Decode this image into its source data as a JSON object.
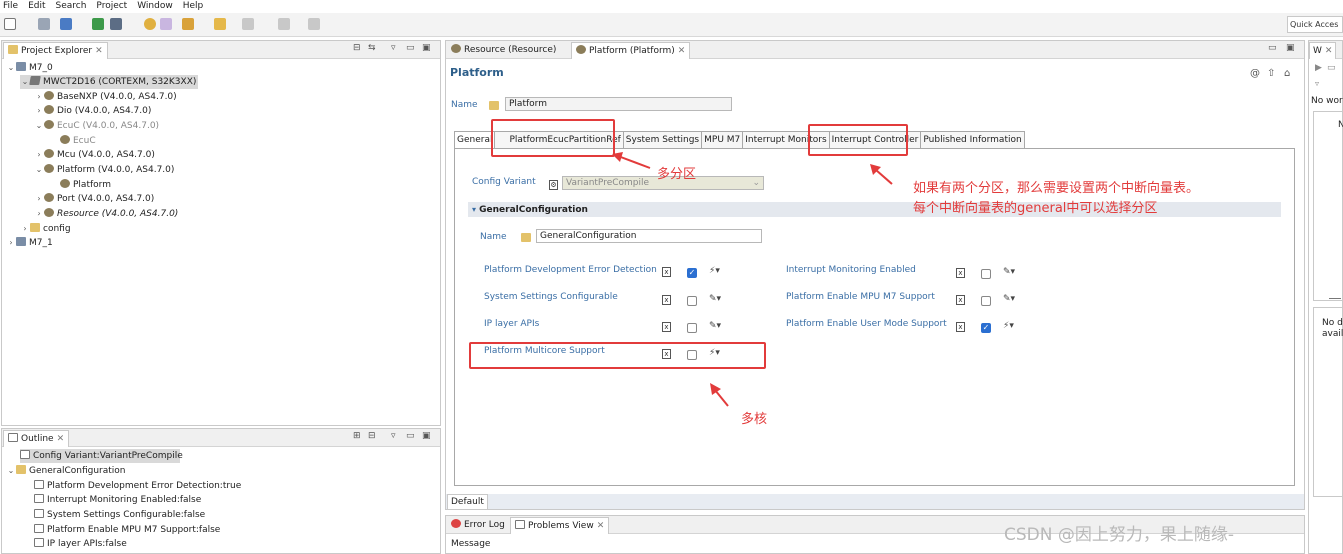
{
  "menu": [
    "File",
    "Edit",
    "Search",
    "Project",
    "Window",
    "Help"
  ],
  "quick_access": "Quick Acces",
  "project_explorer": {
    "tab_label": "Project Explorer",
    "items": [
      {
        "label": "M7_0"
      },
      {
        "label": "MWCT2D16 (CORTEXM, S32K3XX)"
      },
      {
        "label": "BaseNXP (V4.0.0, AS4.7.0)"
      },
      {
        "label": "Dio (V4.0.0, AS4.7.0)"
      },
      {
        "label": "EcuC (V4.0.0, AS4.7.0)"
      },
      {
        "label": "EcuC"
      },
      {
        "label": "Mcu (V4.0.0, AS4.7.0)"
      },
      {
        "label": "Platform (V4.0.0, AS4.7.0)"
      },
      {
        "label": "Platform"
      },
      {
        "label": "Port (V4.0.0, AS4.7.0)"
      },
      {
        "label": "Resource (V4.0.0, AS4.7.0)"
      },
      {
        "label": "config"
      },
      {
        "label": "M7_1"
      }
    ]
  },
  "outline": {
    "tab_label": "Outline",
    "items": [
      {
        "label": "Config Variant:VariantPreCompile"
      },
      {
        "label": "GeneralConfiguration"
      },
      {
        "label": "Platform Development Error Detection:true"
      },
      {
        "label": "Interrupt Monitoring Enabled:false"
      },
      {
        "label": "System Settings Configurable:false"
      },
      {
        "label": "Platform Enable MPU M7 Support:false"
      },
      {
        "label": "IP layer APIs:false"
      }
    ]
  },
  "editor": {
    "tabs": [
      {
        "label": "Resource (Resource)"
      },
      {
        "label": "Platform (Platform)"
      }
    ],
    "title": "Platform",
    "name_label": "Name",
    "name_value": "Platform",
    "form_tabs": [
      {
        "label": "General"
      },
      {
        "label": "PlatformEcucPartitionRef"
      },
      {
        "label": "System Settings"
      },
      {
        "label": "MPU M7"
      },
      {
        "label": "Interrupt Monitors"
      },
      {
        "label": "Interrupt Controller"
      },
      {
        "label": "Published Information"
      }
    ],
    "config_variant_label": "Config Variant",
    "config_variant_value": "VariantPreCompile",
    "section_title": "GeneralConfiguration",
    "section_name_label": "Name",
    "section_name_value": "GeneralConfiguration",
    "params": [
      {
        "label": "Platform Development Error Detection",
        "checked": true
      },
      {
        "label": "System Settings Configurable",
        "checked": false
      },
      {
        "label": "IP layer APIs",
        "checked": false
      },
      {
        "label": "Platform Multicore Support",
        "checked": false
      },
      {
        "label": "Interrupt Monitoring Enabled",
        "checked": false
      },
      {
        "label": "Platform Enable MPU M7 Support",
        "checked": false
      },
      {
        "label": "Platform Enable User Mode Support",
        "checked": true
      }
    ],
    "bottom_tab": "Default"
  },
  "bottom_panel": {
    "tabs": [
      {
        "label": "Error Log"
      },
      {
        "label": "Problems View"
      }
    ],
    "column": "Message"
  },
  "right_panel": {
    "tab_label": "W",
    "text1": "No wor",
    "text2": "N",
    "text3a": "No d",
    "text3b": "avail"
  },
  "annotations": {
    "multi_partition": "多分区",
    "explain_line1": "如果有两个分区，那么需要设置两个中断向量表。",
    "explain_line2": "每个中断向量表的general中可以选择分区",
    "multicore": "多核"
  },
  "watermark": "CSDN @因上努力，果上随缘-",
  "colors": {
    "annotation_red": "#e23b3b",
    "link_blue": "#3a6ea5",
    "checkbox_blue": "#2b6fd1"
  }
}
